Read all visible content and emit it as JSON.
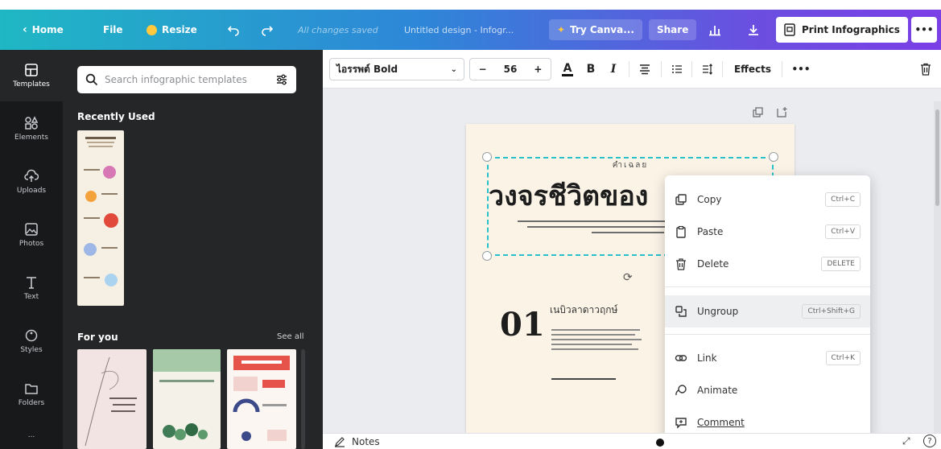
{
  "topbar": {
    "home_label": "Home",
    "file_label": "File",
    "resize_label": "Resize",
    "status_text": "All changes saved",
    "doc_title": "Untitled design - Infogr...",
    "try_canva_label": "Try Canva...",
    "share_label": "Share",
    "print_label": "Print Infographics",
    "more_label": "•••"
  },
  "rail": {
    "items": [
      {
        "label": "Templates"
      },
      {
        "label": "Elements"
      },
      {
        "label": "Uploads"
      },
      {
        "label": "Photos"
      },
      {
        "label": "Text"
      },
      {
        "label": "Styles"
      },
      {
        "label": "Folders"
      },
      {
        "label": "..."
      }
    ]
  },
  "panel": {
    "search_placeholder": "Search infographic templates",
    "recently_used_title": "Recently Used",
    "for_you_title": "For you",
    "see_all_label": "See all"
  },
  "toolbar": {
    "font_name": "ไอรรพต์ Bold",
    "minus_label": "−",
    "font_size": "56",
    "plus_label": "+",
    "text_color_label": "A",
    "bold_label": "B",
    "italic_label": "I",
    "effects_label": "Effects",
    "more_label": "•••"
  },
  "canvas": {
    "small_heading": "คำเฉลย",
    "big_heading": "วงจรชีวิตของ",
    "section_number": "01",
    "section_title": "เนบิวลาดาวฤกษ์"
  },
  "context_menu": {
    "items": [
      {
        "label": "Copy",
        "shortcut": "Ctrl+C",
        "icon": "copy-icon"
      },
      {
        "label": "Paste",
        "shortcut": "Ctrl+V",
        "icon": "clipboard-icon"
      },
      {
        "label": "Delete",
        "shortcut": "DELETE",
        "icon": "trash-icon"
      },
      {
        "label": "Ungroup",
        "shortcut": "Ctrl+Shift+G",
        "icon": "ungroup-icon"
      },
      {
        "label": "Link",
        "shortcut": "Ctrl+K",
        "icon": "link-icon"
      },
      {
        "label": "Animate",
        "shortcut": "",
        "icon": "animate-icon"
      },
      {
        "label": "Comment",
        "shortcut": "",
        "icon": "comment-icon"
      }
    ]
  },
  "bottombar": {
    "notes_label": "Notes"
  },
  "colors": {
    "topbar_gradient_start": "#1fb7c4",
    "topbar_gradient_end": "#7b3fe6",
    "sidebar_bg": "#18191b",
    "panel_bg": "#252627",
    "selection": "#29c0cc",
    "page_bg": "#fbf3e6"
  }
}
